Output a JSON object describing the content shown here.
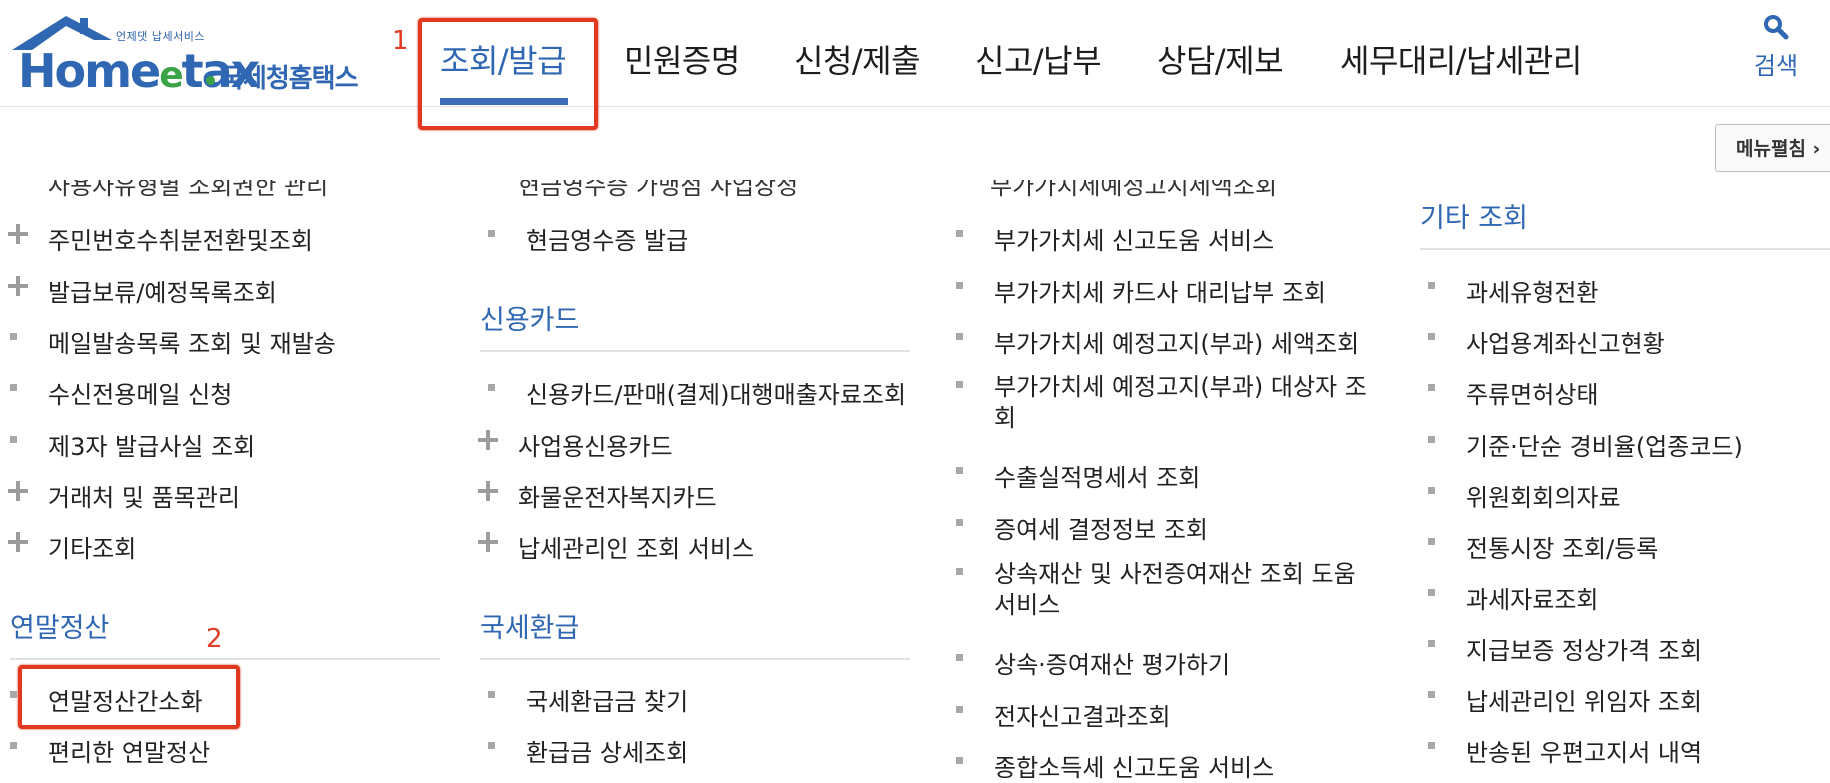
{
  "logo": {
    "tagline": "언제댓 납세서비스",
    "brand": "Home",
    "brand_e": "e",
    "brand_tax": "tax",
    "brand_ko": "국세청홈택스"
  },
  "annotations": {
    "step1": "1",
    "step2": "2",
    "highlight_color": "#e0391f"
  },
  "topnav": {
    "items": [
      "조회/발급",
      "민원증명",
      "신청/제출",
      "신고/납부",
      "상담/제보",
      "세무대리/납세관리"
    ]
  },
  "search": {
    "label": "검색"
  },
  "menu_edit": {
    "label": "메뉴펼침 ›"
  },
  "columns": {
    "col1": {
      "cut_top": "사용자유형별 조회권한 관리",
      "items": [
        "주민번호수취분전환및조회",
        "발급보류/예정목록조회",
        "메일발송목록 조회 및 재발송",
        "수신전용메일 신청",
        "제3자 발급사실 조회",
        "거래처 및 품목관리",
        "기타조회"
      ],
      "section2_title": "연말정산",
      "section2_items": [
        "연말정산간소화",
        "편리한 연말정산"
      ]
    },
    "col2": {
      "cut_top": "현금영수증 가맹점 사업장정",
      "items": [
        "현금영수증 발급"
      ],
      "section_credit_title": "신용카드",
      "credit_items": [
        "신용카드/판매(결제)대행매출자료조회",
        "사업용신용카드",
        "화물운전자복지카드",
        "납세관리인 조회 서비스"
      ],
      "section_refund_title": "국세환급",
      "refund_items": [
        "국세환급금 찾기",
        "환급금 상세조회"
      ]
    },
    "col3": {
      "cut_top": "부가가치세예정고지세액조회",
      "items": [
        "부가가치세 신고도움 서비스",
        "부가가치세 카드사 대리납부 조회",
        "부가가치세 예정고지(부과) 세액조회",
        "부가가치세 예정고지(부과) 대상자 조회",
        "수출실적명세서 조회",
        "증여세 결정정보 조회",
        "상속재산 및 사전증여재산 조회 도움 서비스",
        "상속·증여재산 평가하기",
        "전자신고결과조회",
        "종합소득세 신고도움 서비스"
      ]
    },
    "col4": {
      "section_title": "기타 조회",
      "items": [
        "과세유형전환",
        "사업용계좌신고현황",
        "주류면허상태",
        "기준·단순 경비율(업종코드)",
        "위원회회의자료",
        "전통시장 조회/등록",
        "과세자료조회",
        "지급보증 정상가격 조회",
        "납세관리인 위임자 조회",
        "반송된 우편고지서 내역"
      ]
    }
  }
}
